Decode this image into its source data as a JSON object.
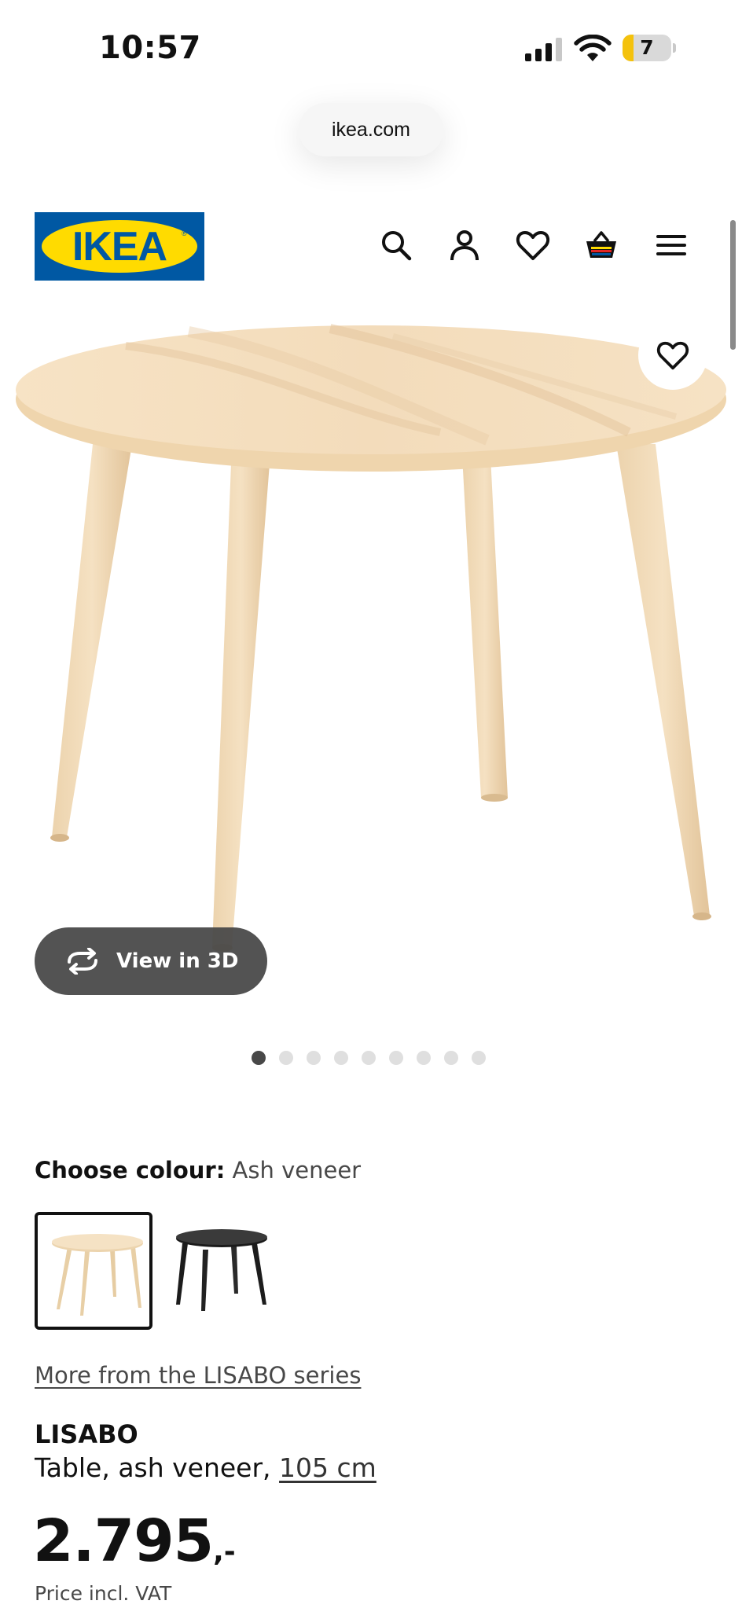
{
  "status_bar": {
    "time": "10:57",
    "battery_level": "7",
    "battery_fraction": 0.07,
    "icons": [
      "cellular-signal-icon",
      "wifi-icon",
      "battery-icon"
    ]
  },
  "browser": {
    "url": "ikea.com"
  },
  "header": {
    "logo_text": "IKEA",
    "logo_colors": {
      "blue": "#0058a3",
      "yellow": "#ffdb00"
    },
    "nav_icons": [
      "search-icon",
      "account-icon",
      "favourites-heart-icon",
      "shopping-bag-icon",
      "menu-icon"
    ]
  },
  "gallery": {
    "view_3d_label": "View in 3D",
    "slide_count": 9,
    "active_slide": 1
  },
  "colour": {
    "label": "Choose colour:",
    "selected": "Ash veneer",
    "options": [
      "Ash veneer",
      "Black"
    ]
  },
  "series_link": "More from the LISABO series",
  "product": {
    "name": "LISABO",
    "description": "Table, ash veneer,",
    "size": "105 cm"
  },
  "price": {
    "amount": "2.795",
    "suffix": ",-",
    "note": "Price incl. VAT"
  }
}
